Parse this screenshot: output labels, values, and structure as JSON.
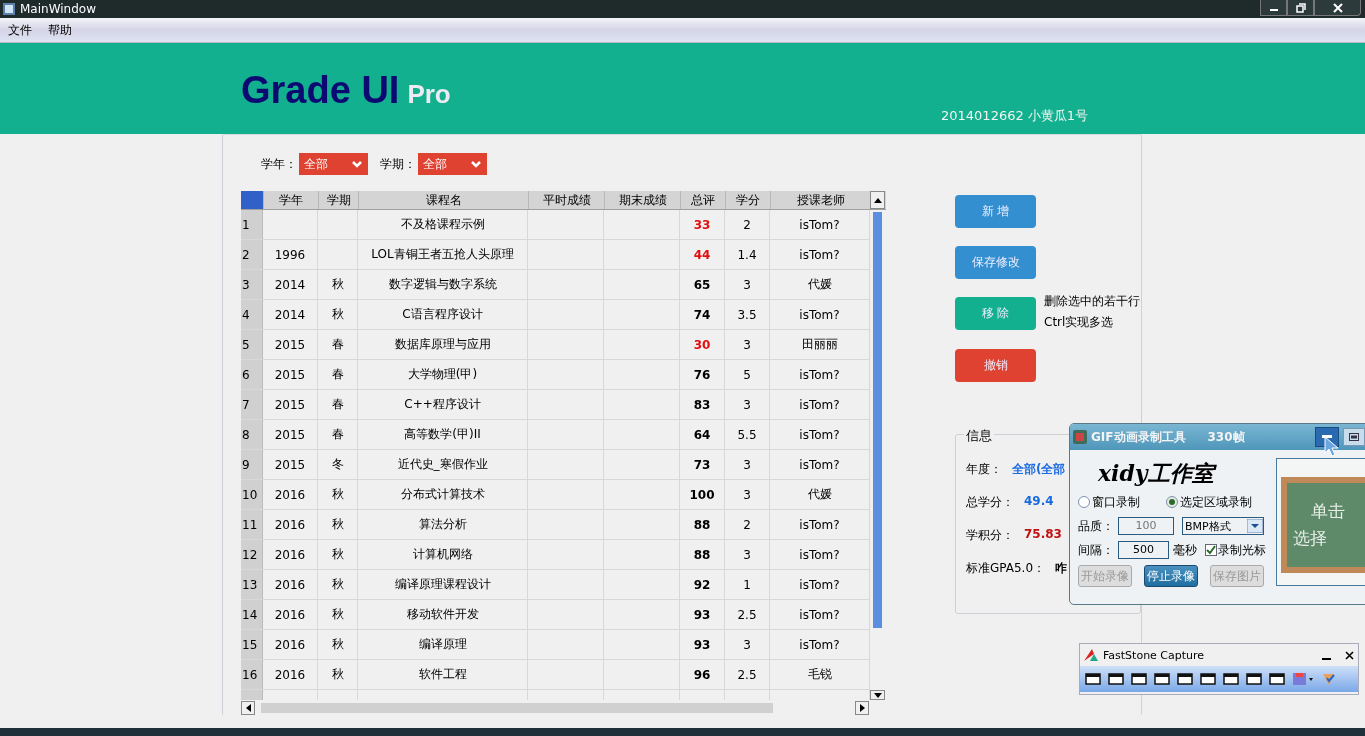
{
  "window": {
    "title": "MainWindow"
  },
  "menu": [
    "文件",
    "帮助"
  ],
  "header": {
    "title": "Grade UI",
    "edition": "Pro",
    "user": "2014012662   小黄瓜1号"
  },
  "filters": [
    {
      "label": "学年：",
      "value": "全部"
    },
    {
      "label": "学期：",
      "value": "全部"
    }
  ],
  "table": {
    "columns": [
      "学年",
      "学期",
      "课程名",
      "平时成绩",
      "期末成绩",
      "总评",
      "学分",
      "授课老师"
    ],
    "rows": [
      {
        "index": "1",
        "year": "",
        "term": "",
        "course": "不及格课程示例",
        "usual": "",
        "final": "",
        "total": "33",
        "failing": true,
        "credit": "2",
        "teacher": "isTom?"
      },
      {
        "index": "2",
        "year": "1996",
        "term": "",
        "course": "LOL青铜王者五抢人头原理",
        "usual": "",
        "final": "",
        "total": "44",
        "failing": true,
        "credit": "1.4",
        "teacher": "isTom?"
      },
      {
        "index": "3",
        "year": "2014",
        "term": "秋",
        "course": "数字逻辑与数字系统",
        "usual": "",
        "final": "",
        "total": "65",
        "failing": false,
        "credit": "3",
        "teacher": "代媛"
      },
      {
        "index": "4",
        "year": "2014",
        "term": "秋",
        "course": "C语言程序设计",
        "usual": "",
        "final": "",
        "total": "74",
        "failing": false,
        "credit": "3.5",
        "teacher": "isTom?"
      },
      {
        "index": "5",
        "year": "2015",
        "term": "春",
        "course": "数据库原理与应用",
        "usual": "",
        "final": "",
        "total": "30",
        "failing": true,
        "credit": "3",
        "teacher": "田丽丽"
      },
      {
        "index": "6",
        "year": "2015",
        "term": "春",
        "course": "大学物理(甲)",
        "usual": "",
        "final": "",
        "total": "76",
        "failing": false,
        "credit": "5",
        "teacher": "isTom?"
      },
      {
        "index": "7",
        "year": "2015",
        "term": "春",
        "course": "C++程序设计",
        "usual": "",
        "final": "",
        "total": "83",
        "failing": false,
        "credit": "3",
        "teacher": "isTom?"
      },
      {
        "index": "8",
        "year": "2015",
        "term": "春",
        "course": "高等数学(甲)II",
        "usual": "",
        "final": "",
        "total": "64",
        "failing": false,
        "credit": "5.5",
        "teacher": "isTom?"
      },
      {
        "index": "9",
        "year": "2015",
        "term": "冬",
        "course": "近代史_寒假作业",
        "usual": "",
        "final": "",
        "total": "73",
        "failing": false,
        "credit": "3",
        "teacher": "isTom?"
      },
      {
        "index": "10",
        "year": "2016",
        "term": "秋",
        "course": "分布式计算技术",
        "usual": "",
        "final": "",
        "total": "100",
        "failing": false,
        "credit": "3",
        "teacher": "代媛"
      },
      {
        "index": "11",
        "year": "2016",
        "term": "秋",
        "course": "算法分析",
        "usual": "",
        "final": "",
        "total": "88",
        "failing": false,
        "credit": "2",
        "teacher": "isTom?"
      },
      {
        "index": "12",
        "year": "2016",
        "term": "秋",
        "course": "计算机网络",
        "usual": "",
        "final": "",
        "total": "88",
        "failing": false,
        "credit": "3",
        "teacher": "isTom?"
      },
      {
        "index": "13",
        "year": "2016",
        "term": "秋",
        "course": "编译原理课程设计",
        "usual": "",
        "final": "",
        "total": "92",
        "failing": false,
        "credit": "1",
        "teacher": "isTom?"
      },
      {
        "index": "14",
        "year": "2016",
        "term": "秋",
        "course": "移动软件开发",
        "usual": "",
        "final": "",
        "total": "93",
        "failing": false,
        "credit": "2.5",
        "teacher": "isTom?"
      },
      {
        "index": "15",
        "year": "2016",
        "term": "秋",
        "course": "编译原理",
        "usual": "",
        "final": "",
        "total": "93",
        "failing": false,
        "credit": "3",
        "teacher": "isTom?"
      },
      {
        "index": "16",
        "year": "2016",
        "term": "秋",
        "course": "软件工程",
        "usual": "",
        "final": "",
        "total": "96",
        "failing": false,
        "credit": "2.5",
        "teacher": "毛锐"
      }
    ]
  },
  "actions": [
    {
      "label": "新 增",
      "kind": "primary"
    },
    {
      "label": "保存修改",
      "kind": "primary"
    },
    {
      "label": "移 除",
      "kind": "success",
      "hint": [
        "删除选中的若干行",
        "Ctrl实现多选"
      ]
    },
    {
      "label": "撤销",
      "kind": "danger"
    }
  ],
  "info": {
    "title": "信息",
    "items": [
      {
        "label": "年度：",
        "value": "全部(全部",
        "color": "#1a6ae0"
      },
      {
        "label": "总学分：",
        "value": "49.4",
        "color": "#1a6ae0"
      },
      {
        "label": "学积分：",
        "value": "75.83",
        "color": "#c01010"
      },
      {
        "label": "标准GPA5.0：",
        "value": "咋",
        "color": "#000000"
      }
    ]
  },
  "gif_tool": {
    "title": "GIF动画录制工具",
    "frames": "330帧",
    "logo": "xidy工作室",
    "modes": [
      {
        "label": "窗口录制",
        "selected": false
      },
      {
        "label": "选定区域录制",
        "selected": true
      }
    ],
    "quality_label": "品质：",
    "quality": "100",
    "format": "BMP格式",
    "interval_label": "间隔：",
    "interval": "500",
    "interval_unit": "毫秒",
    "cursor": {
      "label": "录制光标",
      "checked": true
    },
    "buttons": [
      {
        "label": "开始录像",
        "disabled": true
      },
      {
        "label": "停止录像",
        "disabled": false
      },
      {
        "label": "保存图片",
        "disabled": true
      }
    ],
    "board": [
      "单击",
      "选择"
    ]
  },
  "capture_tool": {
    "title": "FastStone Capture"
  }
}
